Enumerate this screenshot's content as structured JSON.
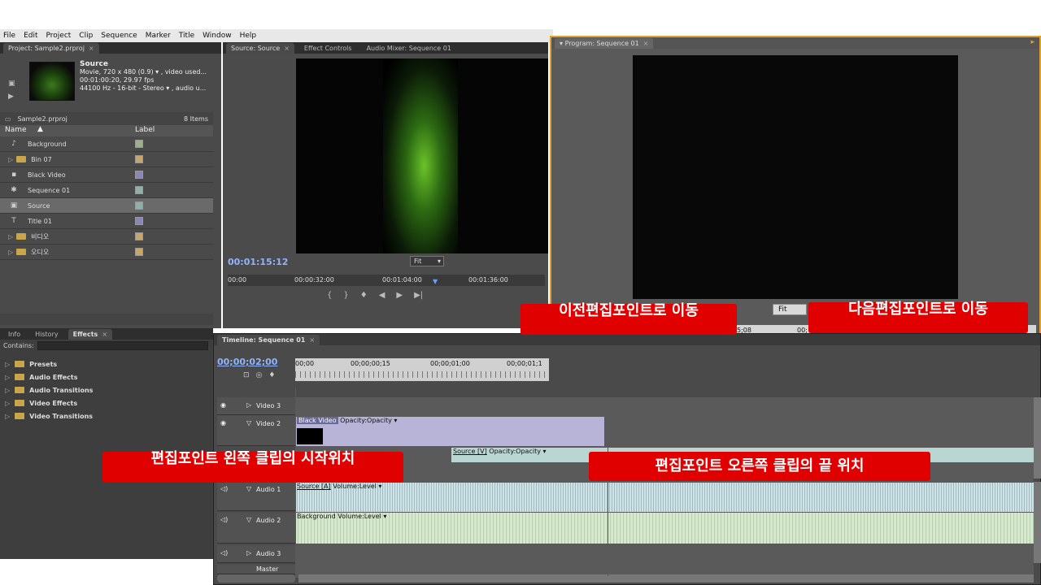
{
  "menu": [
    "File",
    "Edit",
    "Project",
    "Clip",
    "Sequence",
    "Marker",
    "Title",
    "Window",
    "Help"
  ],
  "project": {
    "tab": "Project: Sample2.prproj",
    "clip_name": "Source",
    "clip_line1": "Movie, 720 x 480 (0.9)  ▾ , video used...",
    "clip_line2": "00:01:00:20, 29.97 fps",
    "clip_line3": "44100 Hz - 16-bit - Stereo  ▾ , audio u...",
    "file": "Sample2.prproj",
    "count": "8 Items",
    "col_name": "Name",
    "col_label": "Label",
    "items": [
      {
        "name": "Background",
        "icon": "♪",
        "color": "#9bb08a"
      },
      {
        "name": "Bin 07",
        "icon": "▭",
        "color": "#c7a66a"
      },
      {
        "name": "Black Video",
        "icon": "▪",
        "color": "#8a87b8"
      },
      {
        "name": "Sequence 01",
        "icon": "✱",
        "color": "#8fb0a8"
      },
      {
        "name": "Source",
        "icon": "▣",
        "color": "#8fb0a8"
      },
      {
        "name": "Title 01",
        "icon": "T",
        "color": "#8a87b8"
      },
      {
        "name": "비디오",
        "icon": "▭",
        "color": "#c7a66a"
      },
      {
        "name": "오디오",
        "icon": "▭",
        "color": "#c7a66a"
      }
    ]
  },
  "effects": {
    "tabs": [
      "Info",
      "History",
      "Effects"
    ],
    "contains_label": "Contains:",
    "folders": [
      "Presets",
      "Audio Effects",
      "Audio Transitions",
      "Video Effects",
      "Video Transitions"
    ]
  },
  "source": {
    "tabs": [
      "Source: Source",
      "Effect Controls",
      "Audio Mixer: Sequence 01"
    ],
    "timecode": "00:01:15:12",
    "fit": "Fit",
    "ruler": [
      "00:00",
      "00:00:32:00",
      "00:01:04:00",
      "00:01:36:00"
    ]
  },
  "program": {
    "tab": "Program: Sequence 01",
    "fit": "Fit",
    "ruler": [
      "5;08",
      "00;"
    ]
  },
  "timeline": {
    "tab": "Timeline: Sequence 01",
    "timecode": "00;00;02;00",
    "ruler": [
      "00;00",
      "00;00;00;15",
      "00;00;01;00",
      "00;00;01;1"
    ],
    "tracks": {
      "video3": "Video 3",
      "video2": "Video 2",
      "audio1": "Audio 1",
      "audio2": "Audio 2",
      "audio3": "Audio 3",
      "master": "Master"
    },
    "clips": {
      "black_video": "Black Video",
      "black_video_fx": "Opacity:Opacity ▾",
      "source_v": "Source [V]",
      "source_v_fx": "Opacity:Opacity ▾",
      "source_a": "Source [A]",
      "source_a_fx": "Volume:Level ▾",
      "background": "Background",
      "background_fx": "Volume:Level ▾"
    }
  },
  "callouts": {
    "prev_edit": "이전편집포인트로 이동",
    "next_edit": "다음편집포인트로 이동",
    "left_clip": "편집포인트 왼쪽 클립의 시작위치",
    "right_clip": "편집포인트 오른쪽 클립의 끝 위치"
  },
  "colors": {
    "callout": "#e00000",
    "program_border": "#e0a030",
    "timecode": "#8fb4ff",
    "playhead": "#e02020"
  }
}
